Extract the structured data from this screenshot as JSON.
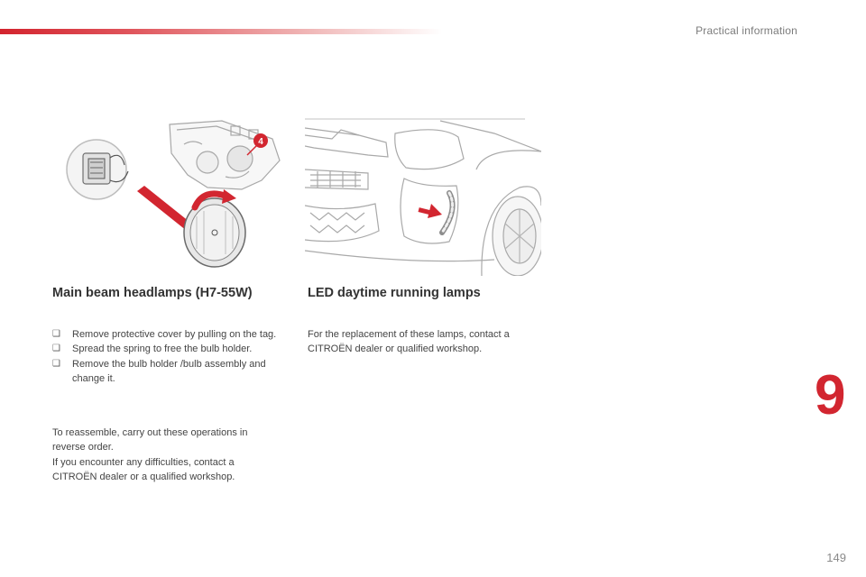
{
  "header": {
    "section_title": "Practical information"
  },
  "illustrations": {
    "left": {
      "callout_number": "4"
    }
  },
  "main_beam": {
    "heading": "Main beam headlamps (H7-55W)",
    "bullet_icon": "check-box-glyph",
    "steps": [
      "Remove protective cover by pulling on the tag.",
      "Spread the spring to free the bulb holder.",
      "Remove the bulb holder /bulb assembly and change it."
    ],
    "reassemble": "To reassemble, carry out these operations in reverse order.",
    "difficulties": "If you encounter any difficulties, contact a CITROËN dealer or a qualified workshop."
  },
  "led": {
    "heading": "LED daytime running lamps",
    "text": "For the replacement of these lamps, contact a CITROËN dealer or qualified workshop."
  },
  "chapter_number": "9",
  "page_number": "149",
  "colors": {
    "accent": "#d22630",
    "line_art": "#9a9a9a"
  }
}
